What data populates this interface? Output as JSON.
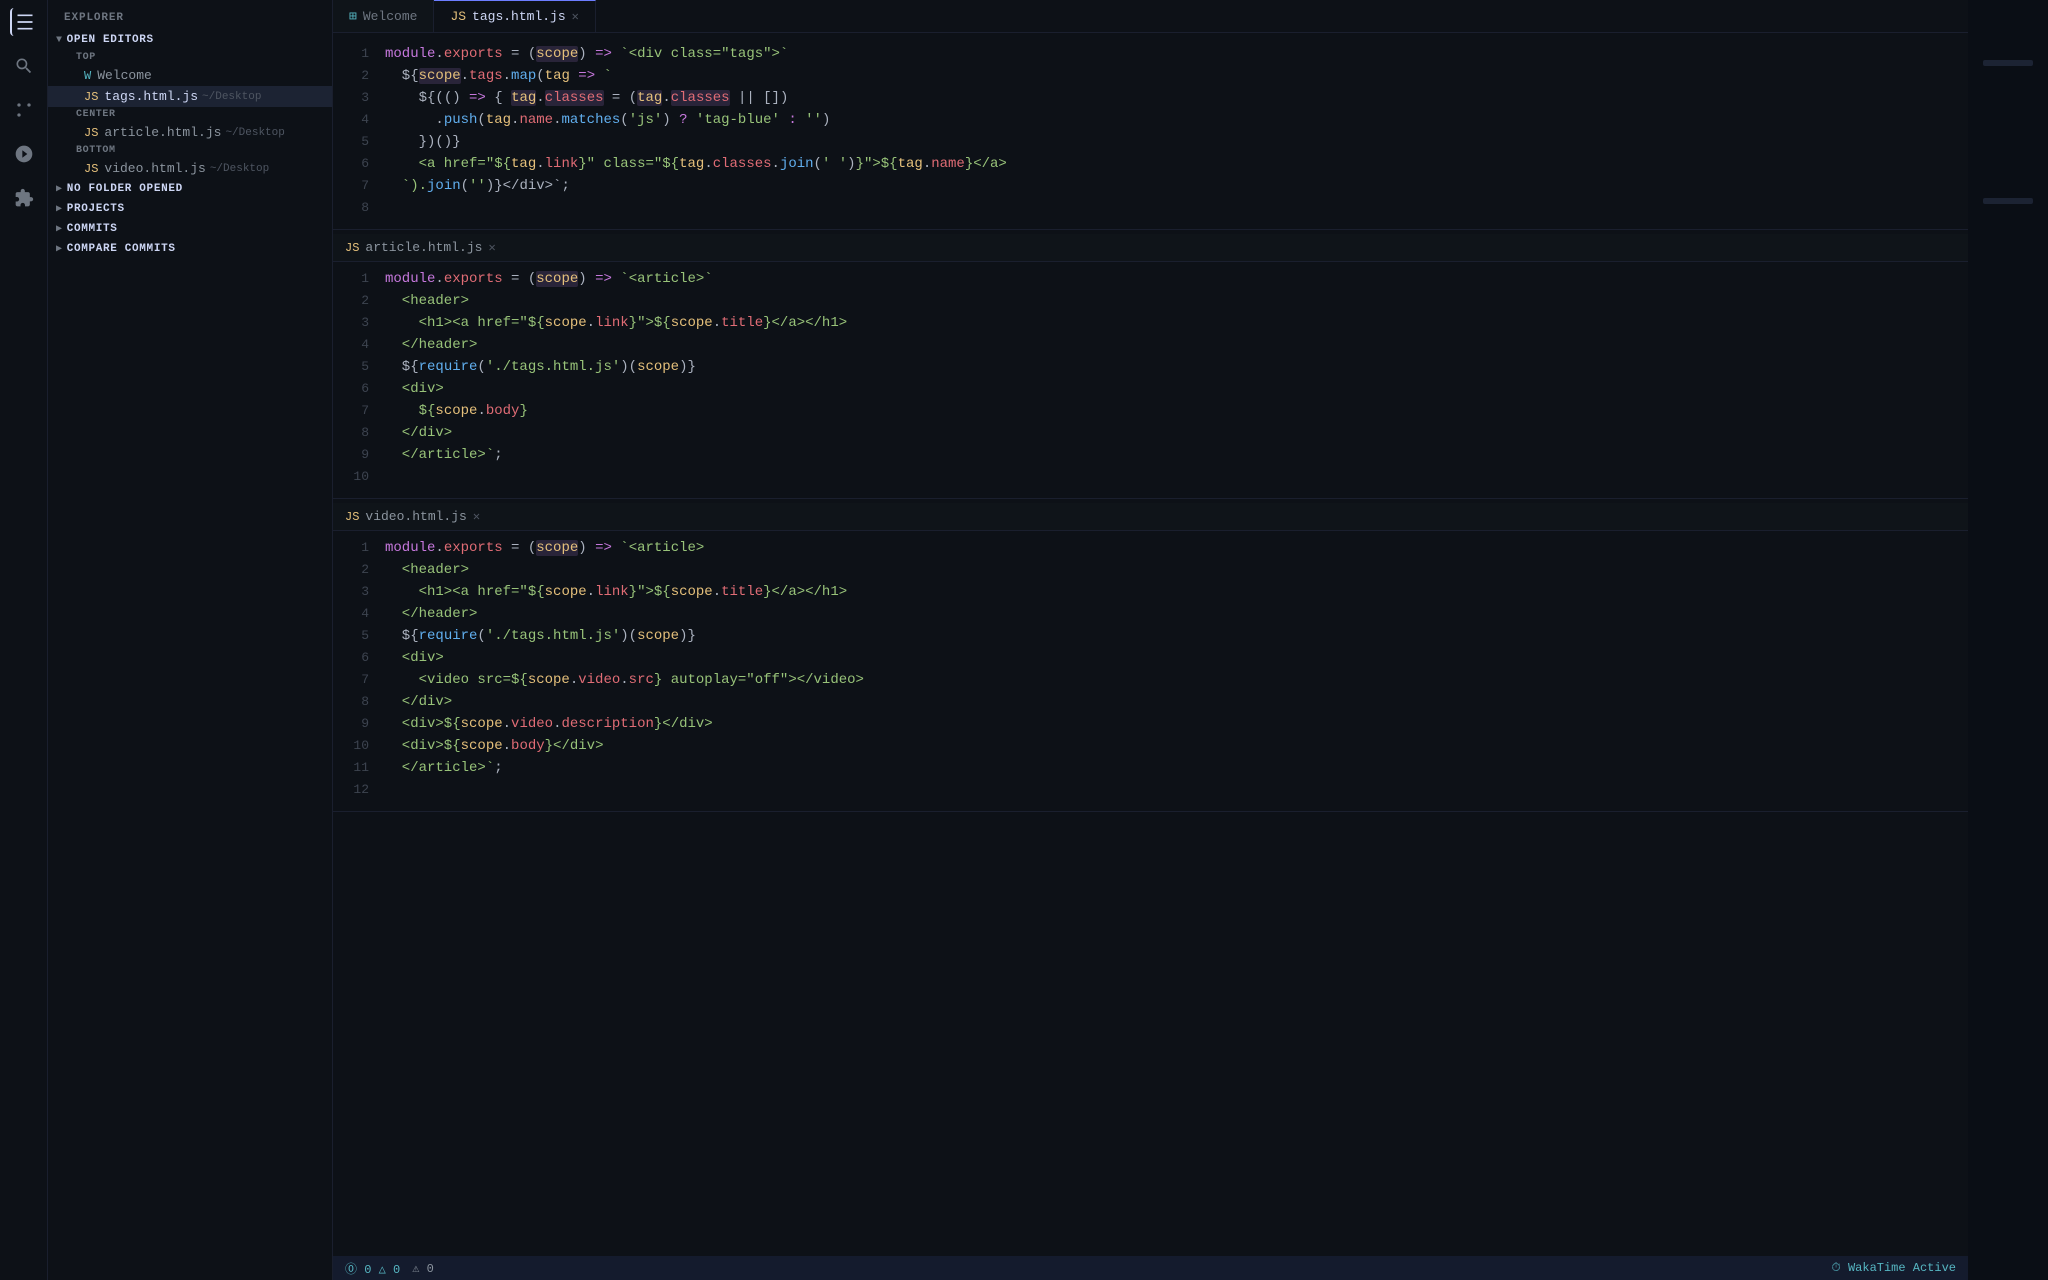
{
  "sidebar": {
    "title": "EXPLORER",
    "sections": {
      "open_editors": {
        "label": "OPEN EDITORS",
        "sub_label_top": "TOP",
        "sub_label_center": "CENTER",
        "sub_label_bottom": "BOTTOM"
      },
      "no_folder": {
        "label": "NO FOLDER OPENED"
      },
      "projects": {
        "label": "PROJECTS"
      },
      "commits": {
        "label": "COMMITS"
      },
      "compare_commits": {
        "label": "COMPARE COMMITS"
      }
    },
    "files": {
      "welcome": {
        "name": "Welcome",
        "icon": "W"
      },
      "tags": {
        "name": "tags.html.js",
        "path": "~/Desktop"
      },
      "article": {
        "name": "article.html.js",
        "path": "~/Desktop"
      },
      "video": {
        "name": "video.html.js",
        "path": "~/Desktop"
      }
    }
  },
  "tabs": [
    {
      "id": "welcome",
      "label": "Welcome",
      "type": "welcome",
      "active": false
    },
    {
      "id": "tags",
      "label": "tags.html.js",
      "type": "js",
      "active": true,
      "closable": true
    }
  ],
  "code_sections": [
    {
      "id": "tags",
      "filename": "tags.html.js",
      "lines": [
        {
          "num": 1,
          "html": "<span class='kw'>module</span><span class='punct'>.</span><span class='prop'>exports</span><span class='punct'> = (</span><span class='param highlight-bg'>scope</span><span class='punct'>) </span><span class='op'>=></span><span class='str'> `&lt;div class=\"tags\"&gt;`</span>"
        },
        {
          "num": 2,
          "html": "<span class='punct'>  $&#123;</span><span class='param highlight-bg'>scope</span><span class='punct'>.</span><span class='prop'>tags</span><span class='punct'>.</span><span class='method'>map</span><span class='punct'>(</span><span class='param'>tag</span><span class='op'> =></span><span class='str'> `</span>"
        },
        {
          "num": 3,
          "html": "<span class='punct'>    $&#123;(</span><span class='punct'>()</span><span class='op'> =></span><span class='punct'> &#123;</span><span class='param'>tag</span><span class='punct'>.</span><span class='prop'>classes</span><span class='punct'> = (</span><span class='param highlight-bg'>tag</span><span class='punct'>.</span><span class='prop highlight-bg'>classes</span><span class='punct'> || </span><span class='bracket'>[]</span><span class='punct'>)</span>"
        },
        {
          "num": 4,
          "html": "<span class='punct'>      .</span><span class='method'>push</span><span class='punct'>(</span><span class='param'>tag</span><span class='punct'>.</span><span class='prop'>name</span><span class='punct'>.</span><span class='method'>matches</span><span class='punct'>(</span><span class='str'>'js'</span><span class='punct'>)</span><span class='op'> ? </span><span class='str'>'tag-blue'</span><span class='op'> : </span><span class='str'>''</span><span class='punct'>)</span>"
        },
        {
          "num": 5,
          "html": "<span class='punct'>    &#125;)()</span><span class='punct'>&#125;</span>"
        },
        {
          "num": 6,
          "html": "<span class='str'>    &lt;a href=\"$&#123;</span><span class='param'>tag</span><span class='punct'>.</span><span class='prop'>link</span><span class='str'>&#125;\" class=\"$&#123;</span><span class='param'>tag</span><span class='punct'>.</span><span class='prop'>classes</span><span class='punct'>.</span><span class='method'>join</span><span class='punct'>(</span><span class='str'>' '</span><span class='punct'>)</span><span class='str'>&#125;\"&gt;$&#123;</span><span class='param'>tag</span><span class='punct'>.</span><span class='prop'>name</span><span class='str'>&#125;&lt;/a&gt;</span>"
        },
        {
          "num": 7,
          "html": "<span class='str'>  `).</span><span class='method'>join</span><span class='punct'>(</span><span class='str'>''</span><span class='punct'>)</span><span class='str'>&#125;&lt;/div&gt;`</span><span class='punct'>;</span>"
        },
        {
          "num": 8,
          "html": ""
        }
      ]
    },
    {
      "id": "article",
      "filename": "article.html.js",
      "lines": [
        {
          "num": 1,
          "html": "<span class='kw'>module</span><span class='punct'>.</span><span class='prop'>exports</span><span class='punct'> = (</span><span class='param highlight-bg'>scope</span><span class='punct'>) </span><span class='op'>=></span><span class='str'> `&lt;article&gt;`</span>"
        },
        {
          "num": 2,
          "html": "<span class='str'>  &lt;header&gt;</span>"
        },
        {
          "num": 3,
          "html": "<span class='str'>    &lt;h1&gt;&lt;a href=\"$&#123;</span><span class='param'>scope</span><span class='punct'>.</span><span class='prop'>link</span><span class='str'>&#125;\"&gt;$&#123;</span><span class='param'>scope</span><span class='punct'>.</span><span class='prop'>title</span><span class='str'>&#125;&lt;/a&gt;&lt;/h1&gt;</span>"
        },
        {
          "num": 4,
          "html": "<span class='str'>  &lt;/header&gt;</span>"
        },
        {
          "num": 5,
          "html": "<span class='str'>  $&#123;</span><span class='fn'>require</span><span class='punct'>(</span><span class='str'>'./tags.html.js'</span><span class='punct'>)(</span><span class='param'>scope</span><span class='punct'>)</span><span class='str'>&#125;</span>"
        },
        {
          "num": 6,
          "html": "<span class='str'>  &lt;div&gt;</span>"
        },
        {
          "num": 7,
          "html": "<span class='str'>    $&#123;</span><span class='param'>scope</span><span class='punct'>.</span><span class='prop'>body</span><span class='str'>&#125;</span>"
        },
        {
          "num": 8,
          "html": "<span class='str'>  &lt;/div&gt;</span>"
        },
        {
          "num": 9,
          "html": "<span class='str'>  &lt;/article&gt;`</span><span class='punct'>;</span>"
        },
        {
          "num": 10,
          "html": ""
        }
      ]
    },
    {
      "id": "video",
      "filename": "video.html.js",
      "lines": [
        {
          "num": 1,
          "html": "<span class='kw'>module</span><span class='punct'>.</span><span class='prop'>exports</span><span class='punct'> = (</span><span class='param highlight-bg'>scope</span><span class='punct'>) </span><span class='op'>=></span><span class='str'> `&lt;article&gt;</span>"
        },
        {
          "num": 2,
          "html": "<span class='str'>  &lt;header&gt;</span>"
        },
        {
          "num": 3,
          "html": "<span class='str'>    &lt;h1&gt;&lt;a href=\"$&#123;</span><span class='param'>scope</span><span class='punct'>.</span><span class='prop'>link</span><span class='str'>&#125;\"&gt;$&#123;</span><span class='param'>scope</span><span class='punct'>.</span><span class='prop'>title</span><span class='str'>&#125;&lt;/a&gt;&lt;/h1&gt;</span>"
        },
        {
          "num": 4,
          "html": "<span class='str'>  &lt;/header&gt;</span>"
        },
        {
          "num": 5,
          "html": "<span class='str'>  $&#123;</span><span class='fn'>require</span><span class='punct'>(</span><span class='str'>'./tags.html.js'</span><span class='punct'>)(</span><span class='param'>scope</span><span class='punct'>)</span><span class='str'>&#125;</span>"
        },
        {
          "num": 6,
          "html": "<span class='str'>  &lt;div&gt;</span>"
        },
        {
          "num": 7,
          "html": "<span class='str'>    &lt;video src=$&#123;</span><span class='param'>scope</span><span class='punct'>.</span><span class='prop'>video</span><span class='punct'>.</span><span class='prop'>src</span><span class='str'>&#125; autoplay=\"off\"&gt;&lt;/video&gt;</span>"
        },
        {
          "num": 8,
          "html": "<span class='str'>  &lt;/div&gt;</span>"
        },
        {
          "num": 9,
          "html": "<span class='str'>  &lt;div&gt;$&#123;</span><span class='param'>scope</span><span class='punct'>.</span><span class='prop'>video</span><span class='punct'>.</span><span class='prop'>description</span><span class='str'>&#125;&lt;/div&gt;</span>"
        },
        {
          "num": 10,
          "html": "<span class='str'>  &lt;div&gt;$&#123;</span><span class='param'>scope</span><span class='punct'>.</span><span class='prop'>body</span><span class='str'>&#125;&lt;/div&gt;</span>"
        },
        {
          "num": 11,
          "html": "<span class='str'>  &lt;/article&gt;`</span><span class='punct'>;</span>"
        },
        {
          "num": 12,
          "html": ""
        }
      ]
    }
  ],
  "status_bar": {
    "left": [
      {
        "id": "git",
        "text": "⓪ 0 △ 0"
      },
      {
        "id": "errors",
        "text": "⚠ 0"
      }
    ],
    "right": [
      {
        "id": "wakatime",
        "text": "⏱ WakaTime Active"
      }
    ]
  }
}
